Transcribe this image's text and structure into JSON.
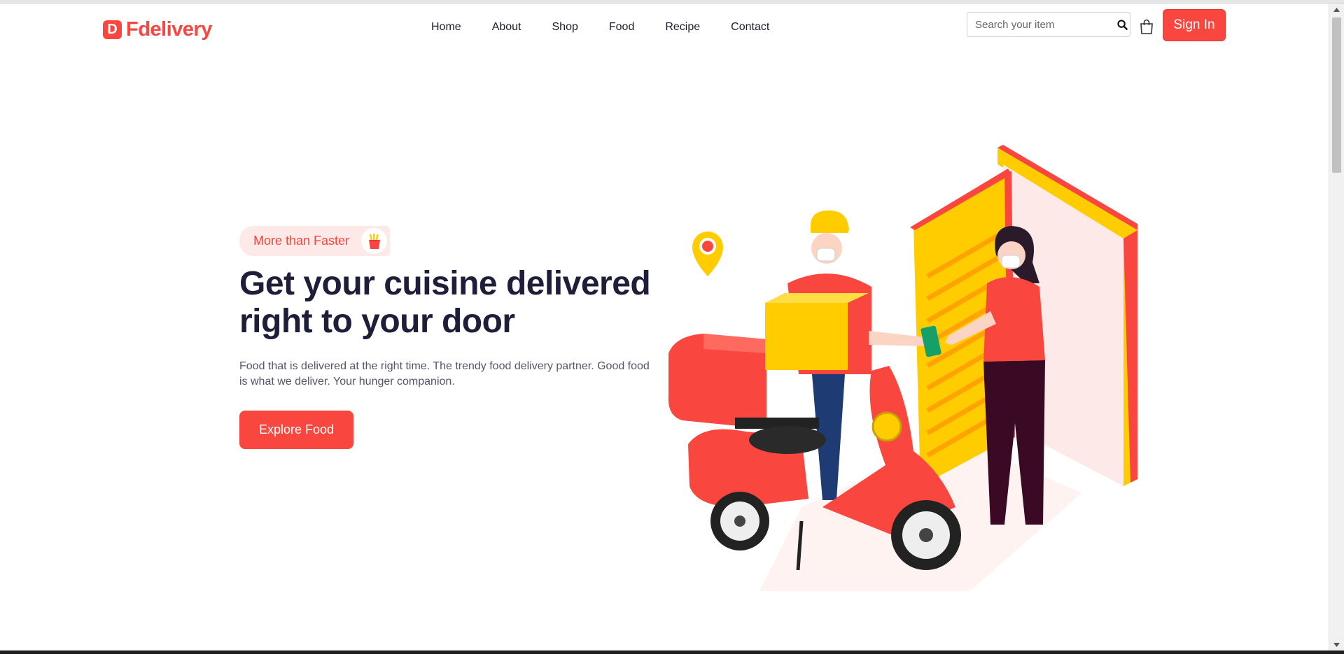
{
  "header": {
    "logo_letter": "D",
    "logo_text": "Fdelivery",
    "nav": [
      {
        "label": "Home"
      },
      {
        "label": "About"
      },
      {
        "label": "Shop"
      },
      {
        "label": "Food"
      },
      {
        "label": "Recipe"
      },
      {
        "label": "Contact"
      }
    ],
    "search": {
      "placeholder": "Search your item",
      "value": ""
    },
    "signin_label": "Sign In"
  },
  "hero": {
    "badge_text": "More than Faster",
    "badge_icon": "french-fries-icon",
    "title_line1": "Get your cuisine delivered",
    "title_line2": "right to your door",
    "description": "Food that is delivered at the right time. The trendy food delivery partner. Good food is what we deliver. Your hunger companion.",
    "cta_label": "Explore Food"
  },
  "colors": {
    "accent": "#f9473f",
    "heading": "#1e1e3a",
    "badge_bg": "#fde9e7",
    "yellow": "#ffcc00"
  }
}
